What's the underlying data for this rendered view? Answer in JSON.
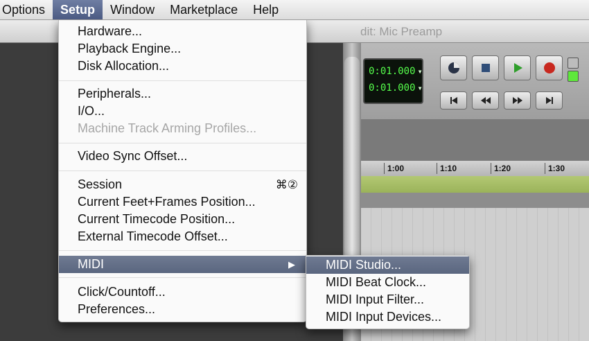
{
  "menubar": {
    "items": [
      {
        "label": "Options"
      },
      {
        "label": "Setup"
      },
      {
        "label": "Window"
      },
      {
        "label": "Marketplace"
      },
      {
        "label": "Help"
      }
    ]
  },
  "background_window": {
    "title": "dit: Mic Preamp",
    "counter": {
      "main": "0:01.000",
      "sub": "0:01.000"
    },
    "ruler_ticks": [
      "1:00",
      "1:10",
      "1:20",
      "1:30"
    ]
  },
  "setup_menu": {
    "groups": [
      [
        {
          "label": "Hardware..."
        },
        {
          "label": "Playback Engine..."
        },
        {
          "label": "Disk Allocation..."
        }
      ],
      [
        {
          "label": "Peripherals..."
        },
        {
          "label": "I/O..."
        },
        {
          "label": "Machine Track Arming Profiles...",
          "disabled": true
        }
      ],
      [
        {
          "label": "Video Sync Offset..."
        }
      ],
      [
        {
          "label": "Session",
          "shortcut": "⌘②"
        },
        {
          "label": "Current Feet+Frames Position..."
        },
        {
          "label": "Current Timecode Position..."
        },
        {
          "label": "External Timecode Offset..."
        }
      ],
      [
        {
          "label": "MIDI",
          "submenu": true,
          "arrow": "▶"
        }
      ],
      [
        {
          "label": "Click/Countoff..."
        },
        {
          "label": "Preferences..."
        }
      ]
    ]
  },
  "midi_submenu": {
    "items": [
      {
        "label": "MIDI Studio..."
      },
      {
        "label": "MIDI Beat Clock..."
      },
      {
        "label": "MIDI Input Filter..."
      },
      {
        "label": "MIDI Input Devices..."
      }
    ]
  },
  "colors": {
    "highlight": "#5f6b84",
    "counter_text": "#56ff4c",
    "record_red": "#c8281f",
    "play_green": "#2e9e2a"
  }
}
